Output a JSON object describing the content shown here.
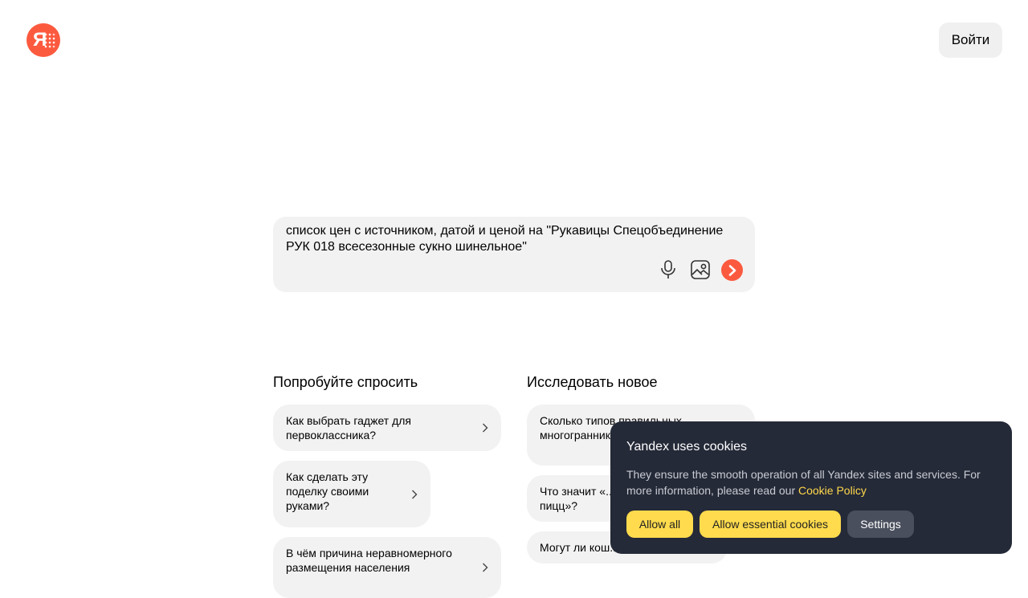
{
  "header": {
    "logo_letter": "Я",
    "login_label": "Войти"
  },
  "search": {
    "query": "список цен с источником, датой и ценой на \"Рукавицы Спецобъединение РУК 018 всесезонные сукно шинельное\""
  },
  "suggestions": {
    "try_title": "Попробуйте спросить",
    "try_items": [
      {
        "label": "Как выбрать гаджет для первоклассника?"
      },
      {
        "label": "Как сделать эту поделку своими руками?"
      },
      {
        "label": "В чём причина неравномерного размещения населения"
      }
    ],
    "explore_title": "Исследовать новое",
    "explore_items": [
      {
        "label": "Сколько типов правильных многогранников в четырёхмерном"
      },
      {
        "label": "Что значит «... пицц»?"
      },
      {
        "label": "Могут ли кош..."
      }
    ]
  },
  "cookie": {
    "title": "Yandex uses cookies",
    "text": "They ensure the smooth operation of all Yandex sites and services. For more information, please read our ",
    "link": "Cookie Policy",
    "allow_all": "Allow all",
    "allow_essential": "Allow essential cookies",
    "settings": "Settings"
  },
  "colors": {
    "brand": "#fc5a3f",
    "cookie_bg": "#252a38",
    "cookie_accent": "#ffd84b"
  }
}
